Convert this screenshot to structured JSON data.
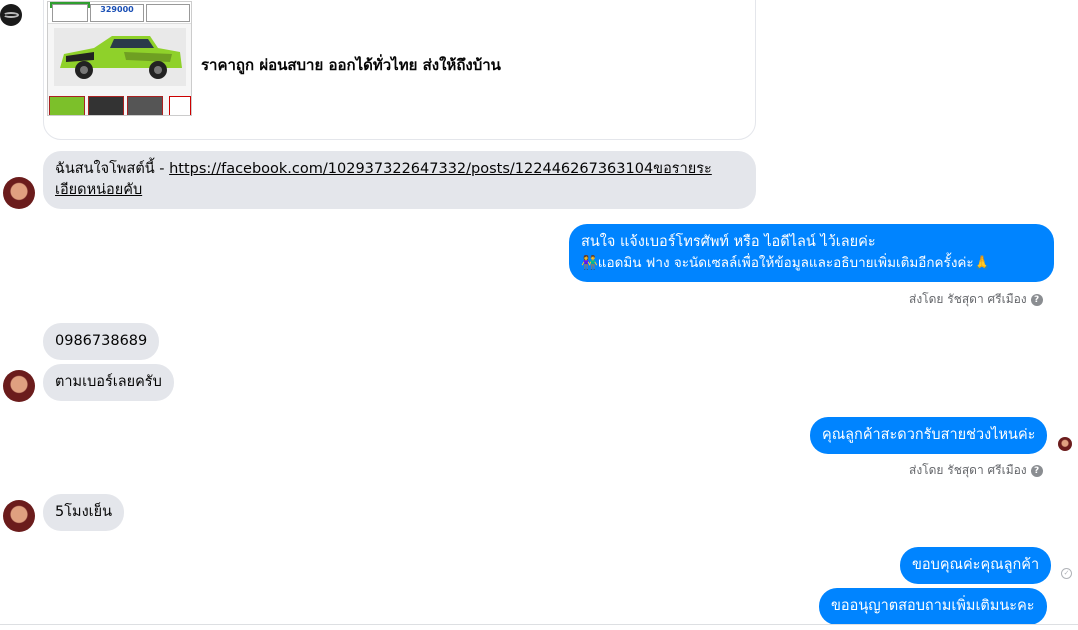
{
  "product_card": {
    "caption": "ราคาถูก ผ่อนสบาย ออกได้ทั่วไทย ส่งให้ถึงบ้าน",
    "price": "329000"
  },
  "messages": [
    {
      "side": "in",
      "prefix": "ฉันสนใจโพสต์นี้ - ",
      "link_line1": "https://facebook.com/102937322647332/posts/122446267363104ขอรายระ",
      "link_line2": "เอียดหน่อยคับ"
    },
    {
      "side": "out",
      "line1": "สนใจ แจ้งเบอร์โทรศัพท์ หรือ ไอดีไลน์  ไว้เลยค่ะ",
      "line2": "👫แอดมิน ฟาง จะนัดเซลล์เพื่อให้ข้อมูลและอธิบายเพิ่มเติมอีกครั้งค่ะ🙏",
      "sent_by": "ส่งโดย รัชสุดา ศรีเมือง"
    },
    {
      "side": "in",
      "text": "0986738689"
    },
    {
      "side": "in",
      "text": "ตามเบอร์เลยครับ"
    },
    {
      "side": "out",
      "text": "คุณลูกค้าสะดวกรับสายช่วงไหนค่ะ",
      "sent_by": "ส่งโดย รัชสุดา ศรีเมือง"
    },
    {
      "side": "in",
      "text": "5โมงเย็น"
    },
    {
      "side": "out",
      "text": "ขอบคุณค่ะคุณลูกค้า"
    },
    {
      "side": "out",
      "text": "ขออนุญาตสอบถามเพิ่มเติมนะคะ"
    }
  ],
  "colors": {
    "outgoing": "#0084ff",
    "incoming": "#e4e6eb",
    "meta": "#65676b"
  }
}
